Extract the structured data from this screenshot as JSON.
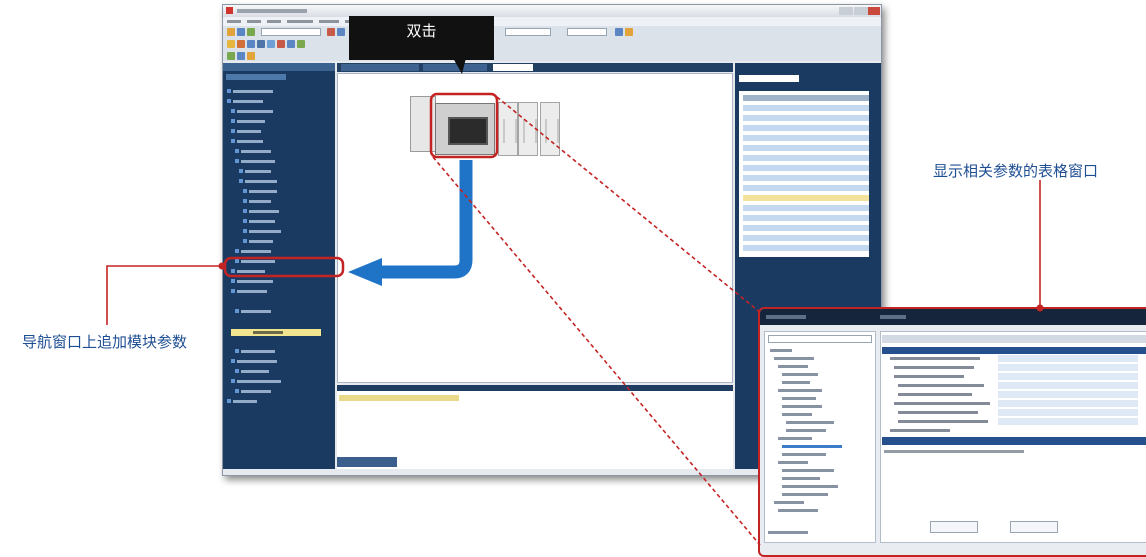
{
  "callouts": {
    "double_click": "双击",
    "table_window": "显示相关参数的表格窗口",
    "nav_add_param": "导航窗口上追加模块参数"
  },
  "colors": {
    "callout_box": "#111111",
    "callout_text": "#1f4f93",
    "highlight_red": "#c42323",
    "arrow_blue": "#1f74c7"
  },
  "icons": {
    "module_highlight": "red-rounded-rect",
    "flow_arrow": "blue-l-arrow",
    "zoom_lines": "red-dotted-lines"
  }
}
